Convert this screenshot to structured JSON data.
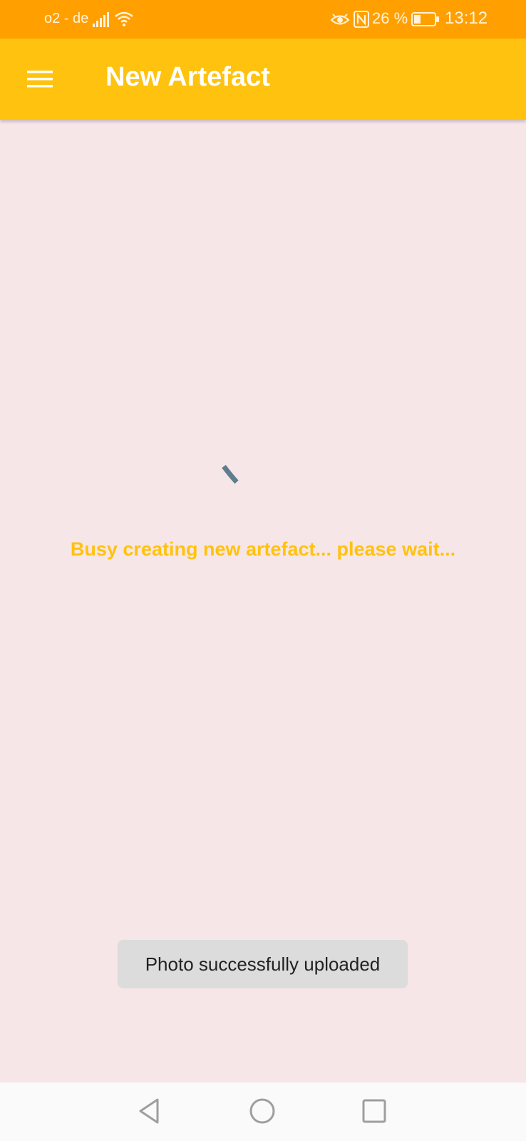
{
  "status_bar": {
    "carrier": "o2 - de",
    "battery_percent": "26 %",
    "time": "13:12",
    "icons": [
      "signal-icon",
      "wifi-icon",
      "eye-icon",
      "nfc-icon",
      "battery-icon"
    ]
  },
  "app_bar": {
    "title": "New Artefact",
    "menu_icon": "hamburger-menu-icon"
  },
  "content": {
    "busy_message": "Busy creating new artefact... please wait...",
    "spinner_icon": "loading-spinner-icon"
  },
  "toast": {
    "message": "Photo successfully uploaded"
  },
  "nav_bar": {
    "icons": [
      "back-icon",
      "home-icon",
      "recents-icon"
    ]
  },
  "colors": {
    "status_bar": "#ffa000",
    "app_bar": "#ffc20e",
    "background": "#f7e6e7",
    "accent_text": "#ffc20e",
    "spinner": "#5f7d8e",
    "toast_bg": "#dcdcdc"
  }
}
